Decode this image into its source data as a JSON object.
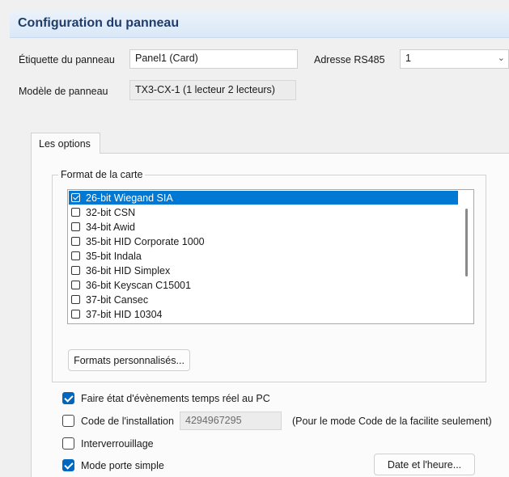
{
  "header": {
    "title": "Configuration du panneau"
  },
  "panel_label": {
    "label": "Étiquette du panneau",
    "value": "Panel1 (Card)"
  },
  "rs485": {
    "label": "Adresse RS485",
    "value": "1"
  },
  "panel_model": {
    "label": "Modèle de panneau",
    "value": "TX3-CX-1 (1 lecteur 2 lecteurs)"
  },
  "tabs": [
    {
      "label": "Les options"
    }
  ],
  "card_format": {
    "title": "Format de la carte",
    "items": [
      {
        "label": "26-bit Wiegand SIA",
        "checked": true,
        "selected": true
      },
      {
        "label": "32-bit CSN",
        "checked": false
      },
      {
        "label": "34-bit Awid",
        "checked": false
      },
      {
        "label": "35-bit HID Corporate 1000",
        "checked": false
      },
      {
        "label": "35-bit Indala",
        "checked": false
      },
      {
        "label": "36-bit HID Simplex",
        "checked": false
      },
      {
        "label": "36-bit Keyscan C15001",
        "checked": false
      },
      {
        "label": "37-bit Cansec",
        "checked": false
      },
      {
        "label": "37-bit HID 10304",
        "checked": false
      }
    ],
    "custom_button": "Formats personnalisés..."
  },
  "options": {
    "realtime_events": {
      "label": "Faire état d'évènements temps réel au PC",
      "checked": true
    },
    "install_code": {
      "label": "Code de l'installation",
      "checked": false,
      "value": "4294967295",
      "note": "(Pour le mode Code de la facilite seulement)"
    },
    "interlock": {
      "label": "Interverrouillage",
      "checked": false
    },
    "single_door": {
      "label": "Mode porte simple",
      "checked": true
    }
  },
  "datetime_button": "Date et l'heure..."
}
